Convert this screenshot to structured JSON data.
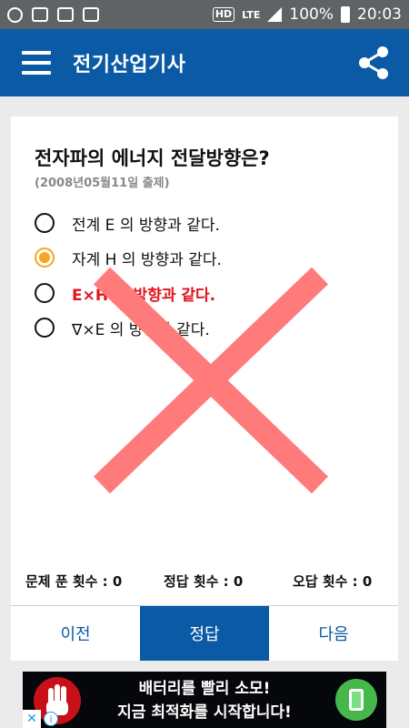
{
  "status_bar": {
    "indicators": [
      "hd-icon",
      "lte-icon",
      "signal-icon",
      "battery-icon"
    ],
    "hd": "HD",
    "lte": "LTE",
    "battery": "100%",
    "time": "20:03"
  },
  "app_bar": {
    "title": "전기산업기사",
    "menu_icon": "hamburger-menu-icon",
    "share_icon": "share-icon",
    "color": "#0b5aa6"
  },
  "question": {
    "text": "전자파의 에너지 전달방향은?",
    "source": "(2008년05월11일 출제)",
    "options": [
      {
        "label": "전계 E 의 방향과 같다.",
        "selected": false,
        "correct": false
      },
      {
        "label": "자계 H 의 방향과 같다.",
        "selected": true,
        "correct": false
      },
      {
        "label": "E×H 의 방향과 같다.",
        "selected": false,
        "correct": true
      },
      {
        "label": "∇×E 의 방향과 같다.",
        "selected": false,
        "correct": false
      }
    ],
    "result_mark": "wrong-x-mark",
    "colors": {
      "selected": "#f5a623",
      "correct": "#e0141e",
      "wrong_mark": "#ff7b7b"
    }
  },
  "stats": {
    "solved": "문제 푼 횟수 : 0",
    "correct": "정답 횟수 : 0",
    "wrong": "오답 횟수 : 0"
  },
  "buttons": {
    "prev": "이전",
    "answer": "정답",
    "next": "다음"
  },
  "ad": {
    "line1": "배터리를 빨리 소모!",
    "line2": "지금 최적화를 시작합니다!",
    "close": "✕",
    "info": "i"
  }
}
